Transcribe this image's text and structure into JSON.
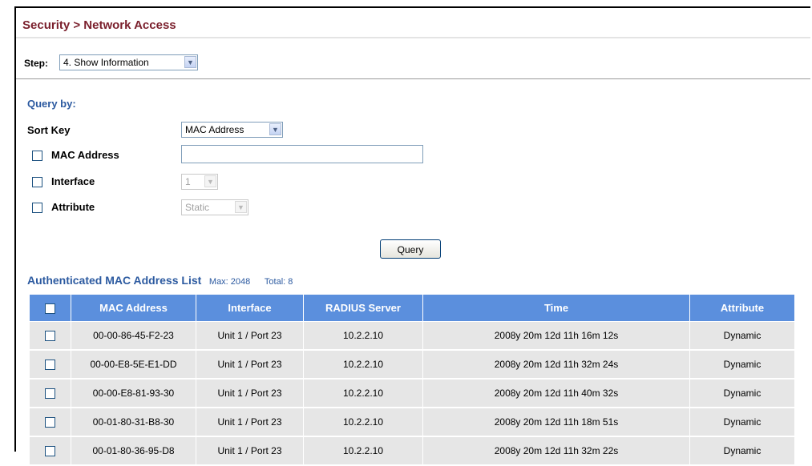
{
  "header": {
    "title": "Security > Network Access"
  },
  "step": {
    "label": "Step:",
    "selected": "4. Show Information"
  },
  "query": {
    "heading": "Query by:",
    "sort_key": {
      "label": "Sort Key",
      "selected": "MAC Address"
    },
    "mac_address": {
      "label": "MAC Address",
      "checked": false,
      "value": ""
    },
    "interface": {
      "label": "Interface",
      "checked": false,
      "selected": "1",
      "disabled": true
    },
    "attribute": {
      "label": "Attribute",
      "checked": false,
      "selected": "Static",
      "disabled": true
    },
    "button_label": "Query"
  },
  "list": {
    "title": "Authenticated MAC Address List",
    "max": "Max: 2048",
    "total": "Total: 8",
    "columns": [
      "MAC Address",
      "Interface",
      "RADIUS Server",
      "Time",
      "Attribute"
    ],
    "rows": [
      {
        "mac": "00-00-86-45-F2-23",
        "interface": "Unit 1 / Port 23",
        "radius": "10.2.2.10",
        "time": "2008y 20m 12d 11h 16m 12s",
        "attribute": "Dynamic"
      },
      {
        "mac": "00-00-E8-5E-E1-DD",
        "interface": "Unit 1 / Port 23",
        "radius": "10.2.2.10",
        "time": "2008y 20m 12d 11h 32m 24s",
        "attribute": "Dynamic"
      },
      {
        "mac": "00-00-E8-81-93-30",
        "interface": "Unit 1 / Port 23",
        "radius": "10.2.2.10",
        "time": "2008y 20m 12d 11h 40m 32s",
        "attribute": "Dynamic"
      },
      {
        "mac": "00-01-80-31-B8-30",
        "interface": "Unit 1 / Port 23",
        "radius": "10.2.2.10",
        "time": "2008y 20m 12d 11h 18m 51s",
        "attribute": "Dynamic"
      },
      {
        "mac": "00-01-80-36-95-D8",
        "interface": "Unit 1 / Port 23",
        "radius": "10.2.2.10",
        "time": "2008y 20m 12d 11h 32m 22s",
        "attribute": "Dynamic"
      }
    ]
  },
  "colors": {
    "title": "#7a1f2c",
    "accent": "#2c5aa0",
    "table_header": "#5b8fdd",
    "table_row": "#e6e6e6"
  },
  "icons": {
    "dropdown": "chevron-down-icon",
    "checkbox": "checkbox-icon"
  }
}
